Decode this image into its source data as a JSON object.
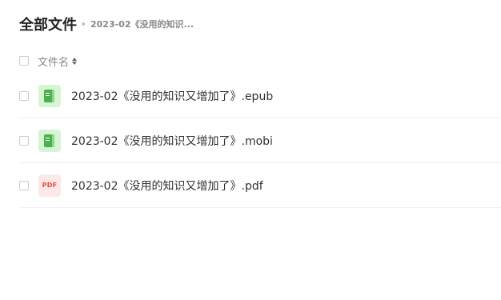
{
  "breadcrumb": {
    "root": "全部文件",
    "current": "2023-02《没用的知识..."
  },
  "list_header": {
    "name_label": "文件名"
  },
  "files": [
    {
      "name": "2023-02《没用的知识又增加了》.epub",
      "icon": "book-icon",
      "badge": ""
    },
    {
      "name": "2023-02《没用的知识又增加了》.mobi",
      "icon": "book-icon",
      "badge": ""
    },
    {
      "name": "2023-02《没用的知识又增加了》.pdf",
      "icon": "pdf-icon",
      "badge": "PDF"
    }
  ],
  "colors": {
    "book_icon_bg": "#d6f5d3",
    "book_icon_fg": "#4caf50",
    "pdf_icon_bg": "#fde8e8",
    "pdf_icon_fg": "#e74c3c"
  }
}
